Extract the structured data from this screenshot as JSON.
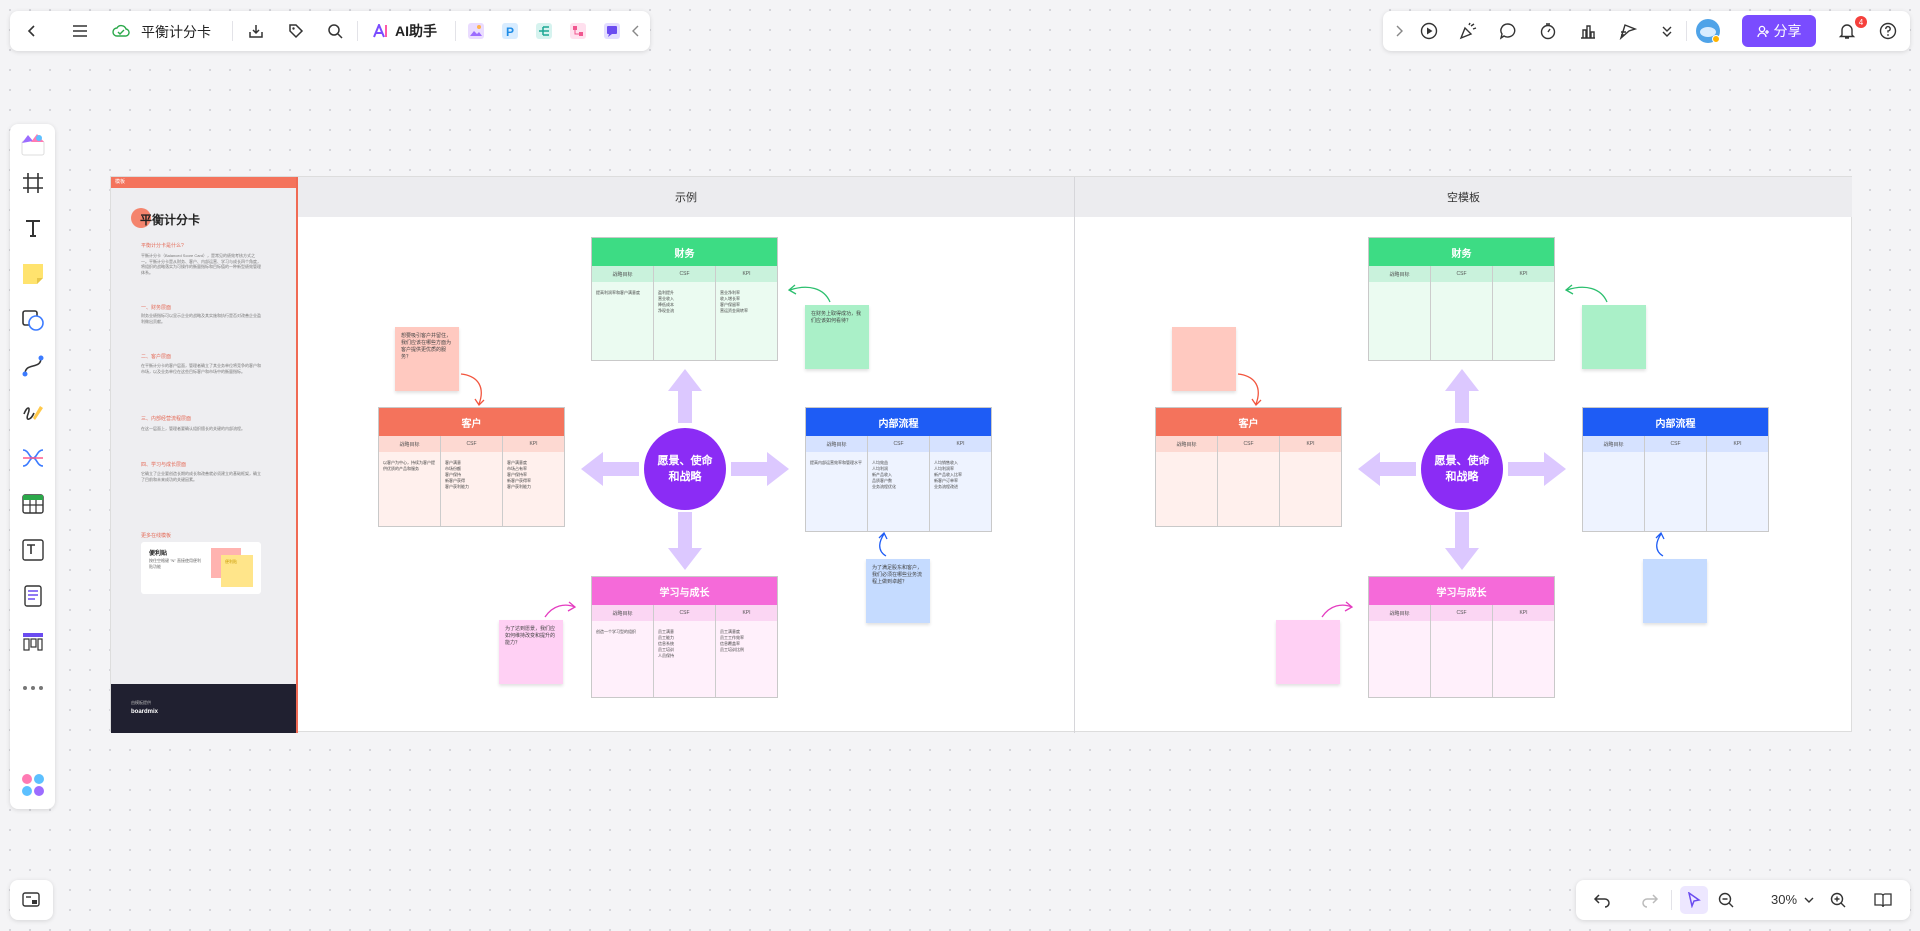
{
  "topbar": {
    "doc_title": "平衡计分卡",
    "ai_label": "AI助手",
    "share_label": "分享",
    "notif_count": "4"
  },
  "zoom": {
    "level": "30%"
  },
  "canvas": {
    "sections": [
      {
        "label": "示例"
      },
      {
        "label": "空模板"
      }
    ],
    "doc": {
      "bar": "模板",
      "title": "平衡计分卡",
      "h1": "平衡计分卡是什么?",
      "p1": "平衡计分卡（Balanced Score Card），是常见的绩效考核方式之一。平衡计分卡是从财务、客户、内部运营、学习与成长四个角度，将组织的战略落实为可操作的衡量指标和目标值的一种新型绩效管理体系。",
      "h2": "一、财务层面",
      "p2": "财务业绩指标可以显示企业的战略及其实施和执行是否对改善企业盈利做出贡献。",
      "h3": "二、客户层面",
      "p3": "在平衡计分卡的客户层面，管理者确立了其业务单位将竞争的客户和市场，以及业务单位在这些目标客户和市场中的衡量指标。",
      "h4": "三、内部经营流程层面",
      "p4": "在这一层面上，管理者要确认组织擅长的关键的内部流程。",
      "h5": "四、学习与成长层面",
      "p5": "它确立了企业要创造长期的成长和改善就必须建立的基础框架，确立了目前和未来成功的关键因素。",
      "h6": "更多在线模板",
      "card_title": "便利贴",
      "card_text": "按住空格键 \"N\" 直接使用便利贴功能",
      "card_sticky": "便利贴",
      "foot_small": "由模板提供",
      "foot_brand": "boardmix"
    },
    "example": {
      "center": "愿景、使命\n和战略",
      "finance": {
        "title": "财务",
        "cols": [
          "战略目标",
          "CSF",
          "KPI"
        ],
        "cells": [
          "提高利润率和客户满意度",
          "盈利提升\n营业收入\n降低成本\n净现金流",
          "营业净利率\n收入增长率\n客户保留率\n营运资金周转率"
        ]
      },
      "customer": {
        "title": "客户",
        "cols": [
          "战略目标",
          "CSF",
          "KPI"
        ],
        "cells": [
          "以客户为中心，持续为客户提供优质的产品和服务",
          "客户满意\n市场份额\n客户保持\n新客户获得\n客户获利能力",
          "客户满意度\n市场占有率\n客户保持率\n新客户获得率\n客户获利能力"
        ]
      },
      "internal": {
        "title": "内部流程",
        "cols": [
          "战略目标",
          "CSF",
          "KPI"
        ],
        "cells": [
          "提高内部运营效率和管理水平",
          "人均效益\n人均利润\n新产品收入\n品质客户数\n业务流程优化",
          "人均销售收入\n人均利润率\n新产品收入比率\n新客户订单率\n业务流程改进"
        ]
      },
      "learning": {
        "title": "学习与成长",
        "cols": [
          "战略目标",
          "CSF",
          "KPI"
        ],
        "cells": [
          "创造一个学习型的组织",
          "员工满意\n员工能力\n信息系统\n员工培训\n人员保持",
          "员工满意度\n员工工作效率\n信息覆盖率\n员工培训比例"
        ]
      },
      "note_customer": "想要吸引客户并留住，我们应该在哪些方面为客户提供更优质的服务？",
      "note_finance": "在财务上取得成功，我们应该如何看待？",
      "note_internal": "为了满足股东和客户，我们必须在哪些业务流程上做到卓越？",
      "note_learning": "为了达到愿景，我们应如何维持改变和提升的能力？"
    },
    "template": {
      "center": "愿景、使命\n和战略",
      "finance": {
        "title": "财务",
        "cols": [
          "战略目标",
          "CSF",
          "KPI"
        ]
      },
      "customer": {
        "title": "客户",
        "cols": [
          "战略目标",
          "CSF",
          "KPI"
        ]
      },
      "internal": {
        "title": "内部流程",
        "cols": [
          "战略目标",
          "CSF",
          "KPI"
        ]
      },
      "learning": {
        "title": "学习与成长",
        "cols": [
          "战略目标",
          "CSF",
          "KPI"
        ]
      }
    }
  },
  "colors": {
    "accent": "#7a4cff",
    "finance": "#3ddc84",
    "customer": "#f4735c",
    "internal": "#1e5cf5",
    "learning": "#f56ad9",
    "center": "#8b2cf5"
  }
}
